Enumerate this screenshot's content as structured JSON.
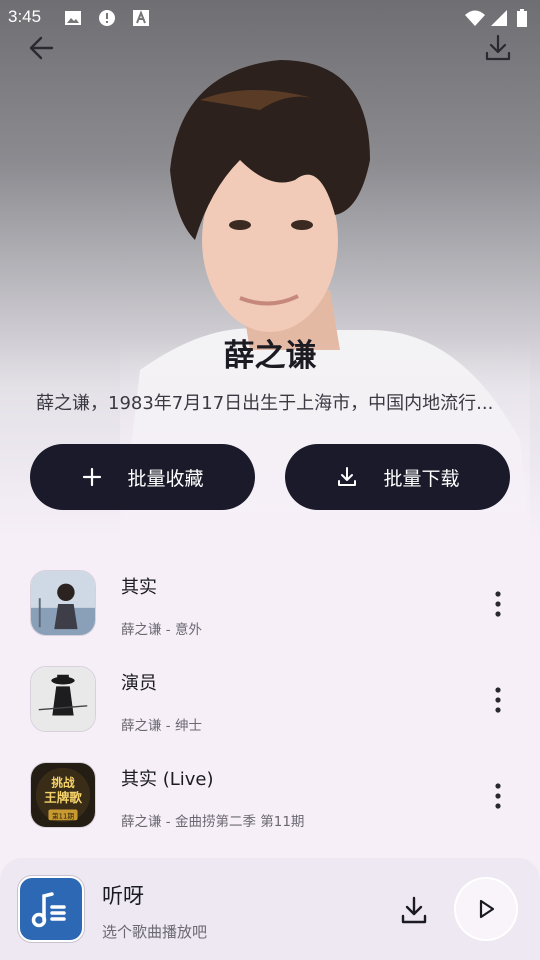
{
  "status_bar": {
    "time": "3:45"
  },
  "artist": {
    "name": "薛之谦",
    "description": "薛之谦，1983年7月17日出生于上海市，中国内地流行..."
  },
  "actions": {
    "collect_label": "批量收藏",
    "download_label": "批量下载"
  },
  "songs": [
    {
      "title": "其实",
      "subtitle": "薛之谦 - 意外"
    },
    {
      "title": "演员",
      "subtitle": "薛之谦 - 绅士"
    },
    {
      "title": "其实 (Live)",
      "subtitle": "薛之谦 - 金曲捞第二季 第11期"
    }
  ],
  "cover_texts": {
    "song3_line1": "挑战",
    "song3_line2": "王牌歌",
    "song3_badge": "第11期"
  },
  "player": {
    "title": "听呀",
    "subtitle": "选个歌曲播放吧"
  },
  "icons": {
    "back": "arrow-left-icon",
    "top_download": "download-icon",
    "collect": "plus-icon",
    "download": "download-icon",
    "more": "more-vert-icon",
    "play": "play-icon",
    "app": "music-note-list-icon"
  },
  "colors": {
    "button_bg": "#1b1a2a",
    "app_icon_bg": "#2c68b4",
    "background": "#f6eff8"
  }
}
